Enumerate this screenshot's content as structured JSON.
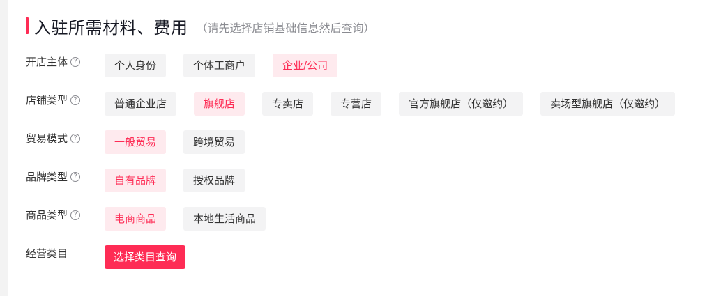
{
  "header": {
    "title": "入驻所需材料、费用",
    "subtitle": "（请先选择店铺基础信息然后查询）"
  },
  "icons": {
    "help": "?"
  },
  "rows": [
    {
      "label": "开店主体",
      "options": [
        "个人身份",
        "个体工商户",
        "企业/公司"
      ],
      "selected": "企业/公司"
    },
    {
      "label": "店铺类型",
      "options": [
        "普通企业店",
        "旗舰店",
        "专卖店",
        "专营店",
        "官方旗舰店（仅邀约）",
        "卖场型旗舰店（仅邀约）"
      ],
      "selected": "旗舰店"
    },
    {
      "label": "贸易模式",
      "options": [
        "一般贸易",
        "跨境贸易"
      ],
      "selected": "一般贸易"
    },
    {
      "label": "品牌类型",
      "options": [
        "自有品牌",
        "授权品牌"
      ],
      "selected": "自有品牌"
    },
    {
      "label": "商品类型",
      "options": [
        "电商商品",
        "本地生活商品"
      ],
      "selected": "电商商品"
    }
  ],
  "category": {
    "label": "经营类目",
    "button_label": "选择类目查询"
  },
  "colors": {
    "accent": "#fe2c55",
    "selected_bg": "#feeaee",
    "option_bg": "#f3f3f4"
  }
}
